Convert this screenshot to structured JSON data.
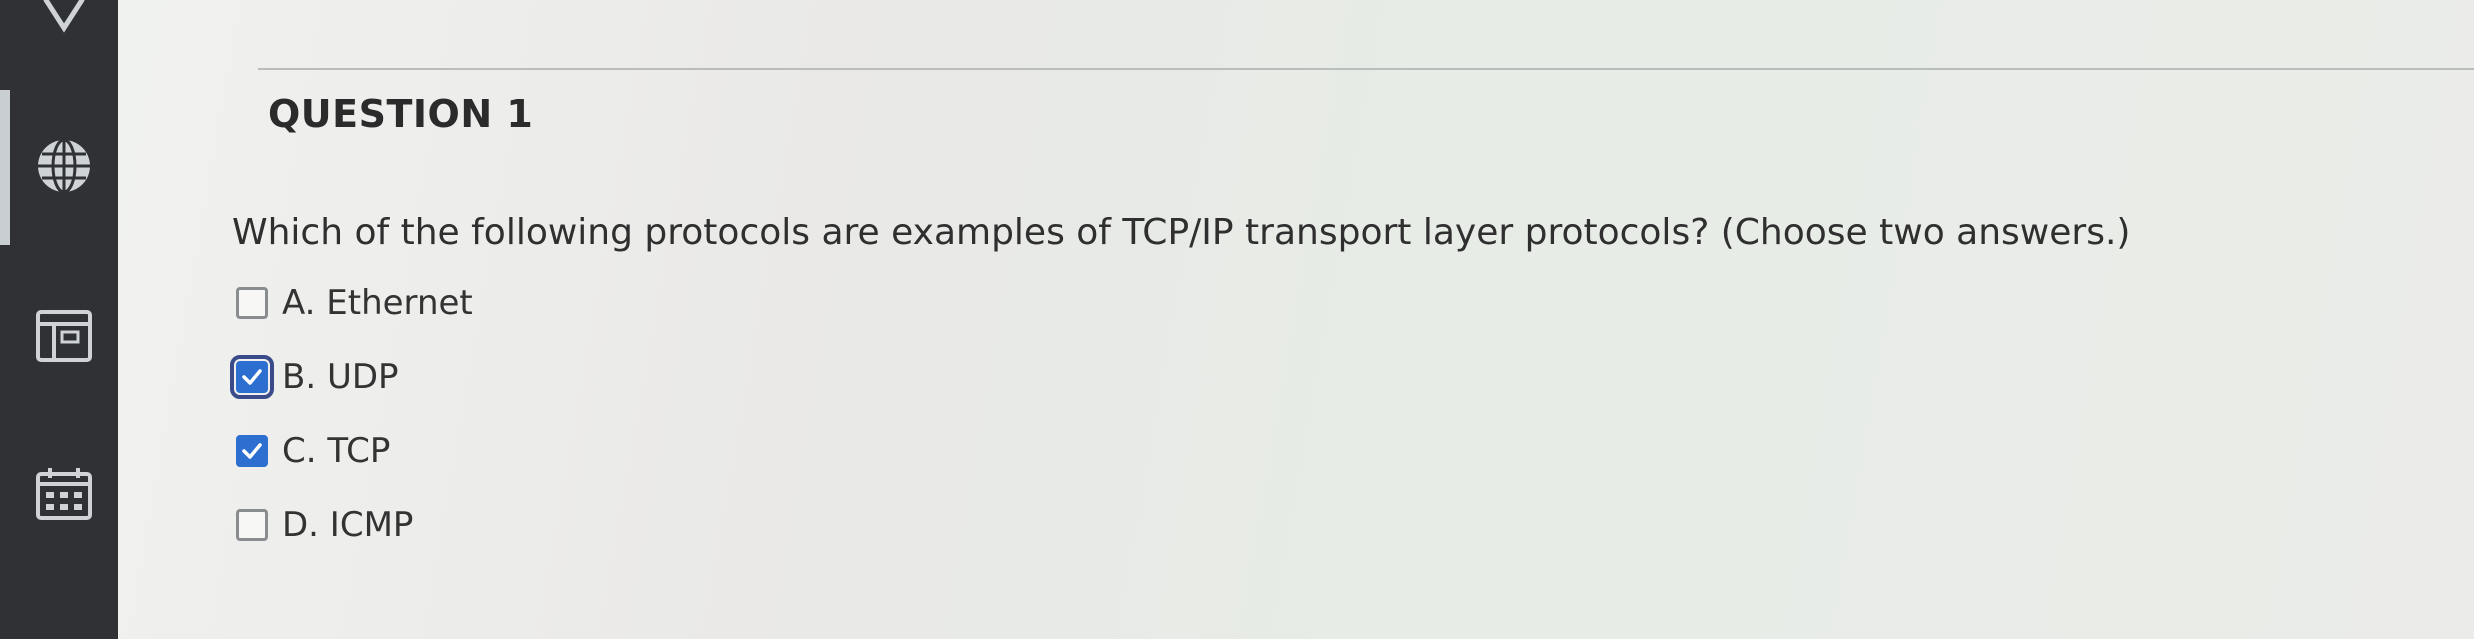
{
  "question": {
    "title": "QUESTION 1",
    "text": "Which of the following protocols are examples of TCP/IP transport layer protocols? (Choose two answers.)",
    "options": [
      {
        "label": "A. Ethernet",
        "checked": false
      },
      {
        "label": "B. UDP",
        "checked": true
      },
      {
        "label": "C. TCP",
        "checked": true
      },
      {
        "label": "D. ICMP",
        "checked": false
      }
    ]
  },
  "sidebar": {
    "icons": [
      "close-icon",
      "globe-icon",
      "browser-window-icon",
      "calendar-icon"
    ]
  },
  "colors": {
    "sidebar": "#2f3134",
    "checkbox_checked": "#2c6fd1",
    "text": "#2f2f2f"
  }
}
